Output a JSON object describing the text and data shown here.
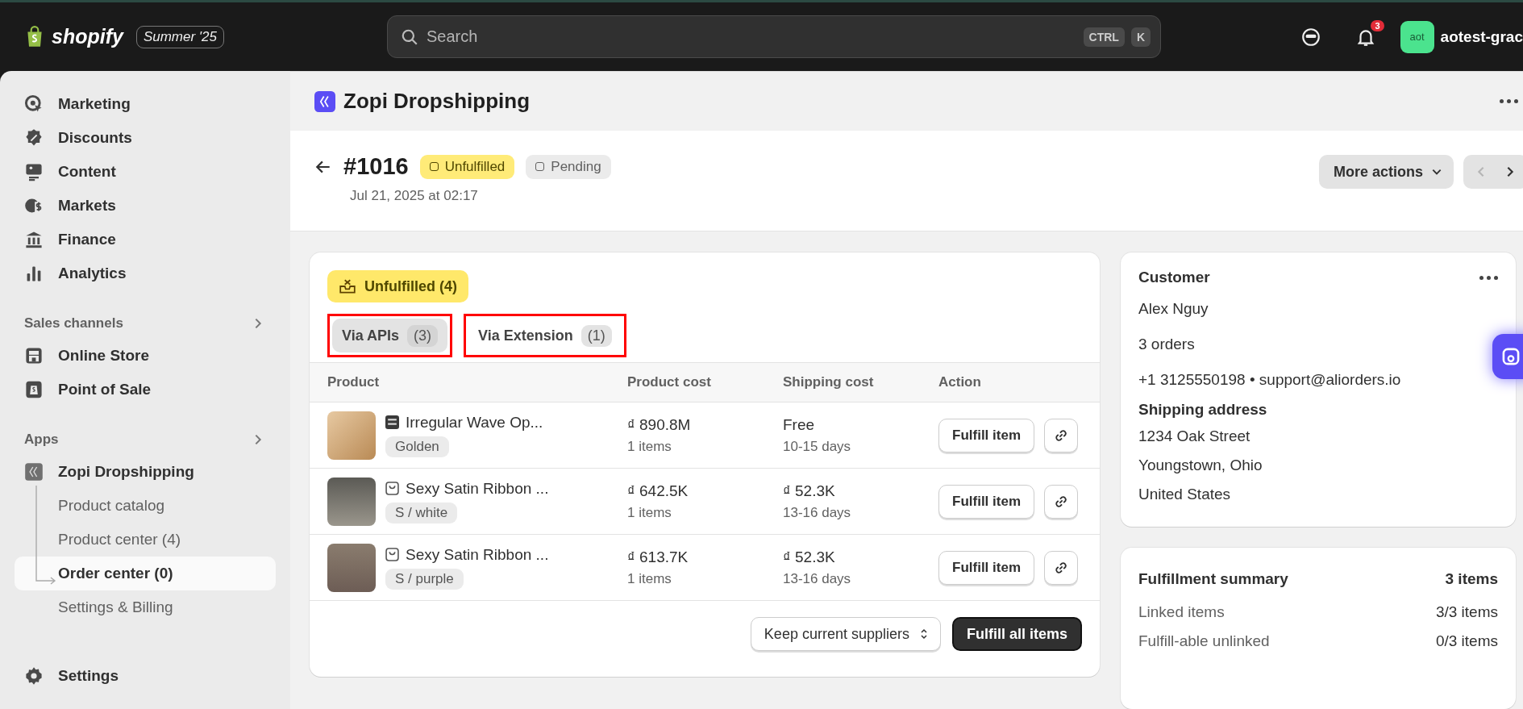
{
  "topbar": {
    "brand": "shopify",
    "edition": "Summer '25",
    "search": {
      "placeholder": "Search"
    },
    "shortcut_keys": [
      "CTRL",
      "K"
    ],
    "notification_count": "3",
    "avatar_initials": "aot",
    "store_name": "aotest-grac"
  },
  "sidebar": {
    "sections": [
      {
        "items": [
          {
            "label": "Marketing",
            "selected": false
          },
          {
            "label": "Discounts",
            "selected": false
          },
          {
            "label": "Content",
            "selected": false
          },
          {
            "label": "Markets",
            "selected": false
          },
          {
            "label": "Finance",
            "selected": false
          },
          {
            "label": "Analytics",
            "selected": false
          }
        ]
      },
      {
        "title": "Sales channels",
        "items": [
          {
            "label": "Online Store",
            "selected": false
          },
          {
            "label": "Point of Sale",
            "selected": false
          }
        ]
      },
      {
        "title": "Apps",
        "items": [
          {
            "label": "Zopi Dropshipping",
            "selected": false,
            "children": [
              {
                "label": "Product catalog",
                "selected": false
              },
              {
                "label": "Product center (4)",
                "selected": false
              },
              {
                "label": "Order center (0)",
                "selected": true
              },
              {
                "label": "Settings & Billing",
                "selected": false
              }
            ]
          }
        ]
      }
    ],
    "bottom_item": {
      "label": "Settings"
    }
  },
  "app_header": {
    "title": "Zopi Dropshipping"
  },
  "order": {
    "number": "#1016",
    "badges": [
      {
        "label": "Unfulfilled",
        "kind": "unfulfilled"
      },
      {
        "label": "Pending",
        "kind": "pending"
      }
    ],
    "date": "Jul 21, 2025 at 02:17",
    "more_actions": "More actions",
    "pager": {
      "previous_disabled": true,
      "next_disabled": false
    }
  },
  "fulfillment": {
    "status_badge": "Unfulfilled (4)",
    "tabs": [
      {
        "label": "Via APIs",
        "count": "(3)",
        "selected": true,
        "highlighted": true
      },
      {
        "label": "Via Extension",
        "count": "(1)",
        "selected": false,
        "highlighted": true
      }
    ],
    "table": {
      "columns": [
        "Product",
        "Product cost",
        "Shipping cost",
        "Action"
      ],
      "rows": [
        {
          "kind": "logo",
          "product": "Irregular Wave Op...",
          "variant": "Golden",
          "cost": "₫ 890.8M",
          "quantity": "1 items",
          "shipping": "Free",
          "delivery": "10-15 days",
          "action": "Fulfill item"
        },
        {
          "kind": "bag",
          "product": "Sexy Satin Ribbon ...",
          "variant": "S / white",
          "cost": "₫ 642.5K",
          "quantity": "1 items",
          "shipping": "₫ 52.3K",
          "delivery": "13-16 days",
          "action": "Fulfill item"
        },
        {
          "kind": "bag",
          "product": "Sexy Satin Ribbon ...",
          "variant": "S / purple",
          "cost": "₫ 613.7K",
          "quantity": "1 items",
          "shipping": "₫ 52.3K",
          "delivery": "13-16 days",
          "action": "Fulfill item"
        }
      ]
    },
    "supplier_select": {
      "value": "Keep current suppliers"
    },
    "fulfill_all": "Fulfill all items"
  },
  "customer": {
    "title": "Customer",
    "name": "Alex Nguy",
    "orders": "3 orders",
    "contact": "+1 3125550198 • support@aliorders.io",
    "shipping_title": "Shipping address",
    "address": [
      "1234 Oak Street",
      "Youngstown, Ohio",
      "United States"
    ]
  },
  "summary": {
    "title": "Fulfillment summary",
    "total": "3 items",
    "rows": [
      {
        "label": "Linked items",
        "value": "3/3 items"
      },
      {
        "label": "Fulfill-able unlinked",
        "value": "0/3 items"
      }
    ]
  }
}
